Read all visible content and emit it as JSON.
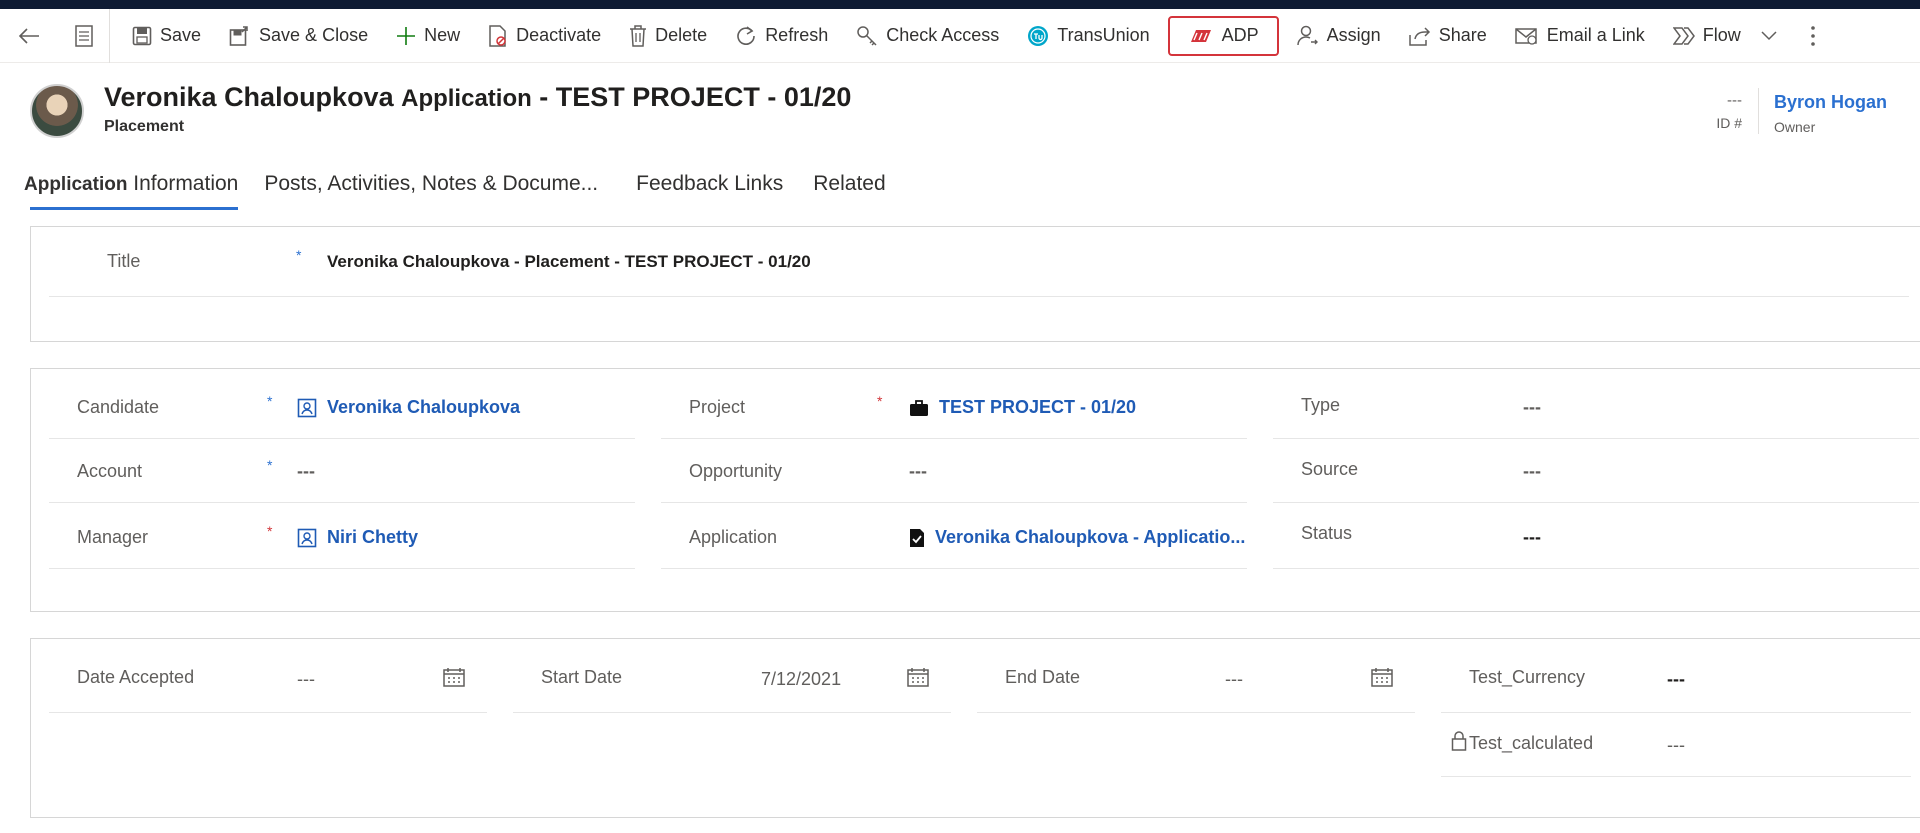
{
  "toolbar": {
    "save": "Save",
    "save_close": "Save & Close",
    "new": "New",
    "deactivate": "Deactivate",
    "delete": "Delete",
    "refresh": "Refresh",
    "check_access": "Check Access",
    "transunion": "TransUnion",
    "adp": "ADP",
    "assign": "Assign",
    "share": "Share",
    "email_link": "Email a Link",
    "flow": "Flow"
  },
  "header": {
    "title_name": "Veronika Chaloupkova",
    "title_app": "Application",
    "title_rest": "- TEST PROJECT - 01/20",
    "subtitle": "Placement",
    "id_value": "---",
    "id_label": "ID #",
    "owner_value": "Byron Hogan",
    "owner_label": "Owner"
  },
  "tabs": {
    "t1_first": "Application",
    "t1_rest": "Information",
    "t2": "Posts, Activities, Notes & Docume...",
    "t3": "Feedback Links",
    "t4": "Related"
  },
  "section1": {
    "title_label": "Title",
    "title_value": "Veronika Chaloupkova - Placement - TEST PROJECT - 01/20"
  },
  "section2": {
    "candidate_label": "Candidate",
    "candidate_value": "Veronika Chaloupkova",
    "account_label": "Account",
    "account_value": "---",
    "manager_label": "Manager",
    "manager_value": "Niri Chetty",
    "project_label": "Project",
    "project_value": "TEST PROJECT - 01/20",
    "opportunity_label": "Opportunity",
    "opportunity_value": "---",
    "application_label": "Application",
    "application_value": "Veronika Chaloupkova - Applicatio...",
    "type_label": "Type",
    "type_value": "---",
    "source_label": "Source",
    "source_value": "---",
    "status_label": "Status",
    "status_value": "---"
  },
  "section3": {
    "date_accepted_label": "Date Accepted",
    "date_accepted_value": "---",
    "start_date_label": "Start Date",
    "start_date_value": "7/12/2021",
    "end_date_label": "End Date",
    "end_date_value": "---",
    "test_currency_label": "Test_Currency",
    "test_currency_value": "---",
    "test_calculated_label": "Test_calculated",
    "test_calculated_value": "---"
  },
  "colors": {
    "accent": "#2b70d0",
    "adp_red": "#d4343b",
    "required_red": "#d13438",
    "topbar": "#0f1b33"
  }
}
